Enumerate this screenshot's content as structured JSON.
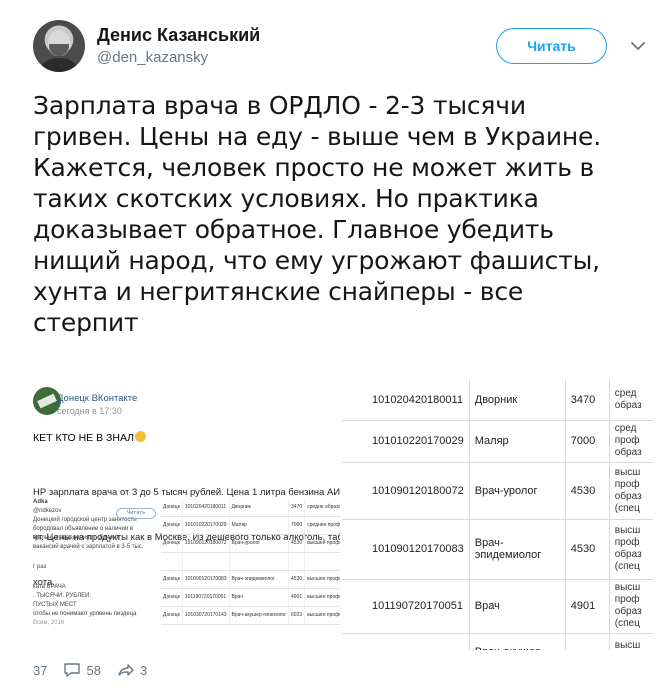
{
  "header": {
    "display_name": "Денис Казанський",
    "handle": "@den_kazansky",
    "follow_label": "Читать"
  },
  "tweet": {
    "lines": [
      "Зарплата врача в ОРДЛО - 2-3 тысячи",
      "гривен. Цены на еду - выше чем в Украине.",
      "Кажется, человек просто не может жить в",
      "таких скотских условиях. Но практика",
      "доказывает обратное. Главное убедить",
      "нищий народ, что ему угрожают фашисты,",
      "хунта и негритянские снайперы - все",
      "стерпит"
    ]
  },
  "vk_post": {
    "group_name": "Донецк ВКонтакте",
    "time": "сегодня в 17:30",
    "headline": "КЕТ КТО НЕ В ЗНАЛ",
    "body_lines": [
      "НР зарплата врача от 3 до 5 тысяч рублей. Цена 1 литра бензина АИ-9",
      "чт. Цены на продукты как в Москве. Из дешевого только алкоголь, таб",
      "хота."
    ],
    "inner_lines_top": [
      "Adka",
      "@ndkezov",
      "Донецкий городской центр занятости",
      "бородовал объявление о наличии в",
      "фильных заведениях г. Донецк",
      "вакансий врачей с зарплатой в 3-5 тыс."
    ],
    "inner_line_raz": "г раз",
    "inner_lines_mid": [
      "ката ВРАЧА",
      ". ТЫСЯЧИ. РУБЛЕЙ.",
      "",
      "ПУСТЫХ МЕСТ",
      "",
      "отобы не понимают уровень пиздеца",
      "Всем, 2016"
    ],
    "inner_button": "Читать",
    "mini_table": [
      [
        "Донецк",
        "101020420180011",
        "Дворник",
        "3470",
        "средне образо"
      ],
      [
        "Донецк",
        "101010220170029",
        "Маляр",
        "7000",
        "среднее профес образо"
      ],
      [
        "Донецк",
        "101090120180072",
        "Врач-уролог",
        "4530",
        "высшее профес образо"
      ],
      [
        "",
        "",
        "",
        "",
        ""
      ],
      [
        "Донецк",
        "101090120170083",
        "Врач-эпидемиолог",
        "4530",
        "высшее профес"
      ],
      [
        "Донецк",
        "101190720170051",
        "Врач",
        "4901",
        "высшее профес образо"
      ],
      [
        "Донецк",
        "101030720170143",
        "Врач-акушер-гинеколог",
        "6023",
        "высшее профес образо"
      ]
    ],
    "actions": {
      "likes": "37",
      "comments": "58",
      "shares": "3"
    }
  },
  "vacancy_table": {
    "rows": [
      {
        "code": "101020420180011",
        "job": "Дворник",
        "salary": "3470",
        "edu": "сред\nобраз"
      },
      {
        "code": "101010220170029",
        "job": "Маляр",
        "salary": "7000",
        "edu": "сред\nпроф\nобраз"
      },
      {
        "code": "101090120180072",
        "job": "Врач-уролог",
        "salary": "4530",
        "edu": "высш\nпроф\nобраз\n(спец"
      },
      {
        "code": "101090120170083",
        "job": "Врач-эпидемиолог",
        "salary": "4530",
        "edu": "высш\nпроф\nобраз\n(спец"
      },
      {
        "code": "101190720170051",
        "job": "Врач",
        "salary": "4901",
        "edu": "высш\nпроф\nобраз\n(спец"
      },
      {
        "code": "101030720170143",
        "job": "Врач-акушер-\nгинеколог",
        "salary": "6023",
        "edu": "высш\nпроф\nобраз"
      }
    ]
  },
  "colors": {
    "accent": "#1da1f2",
    "text": "#14171a",
    "muted": "#657786",
    "vk_link": "#2a5885"
  }
}
